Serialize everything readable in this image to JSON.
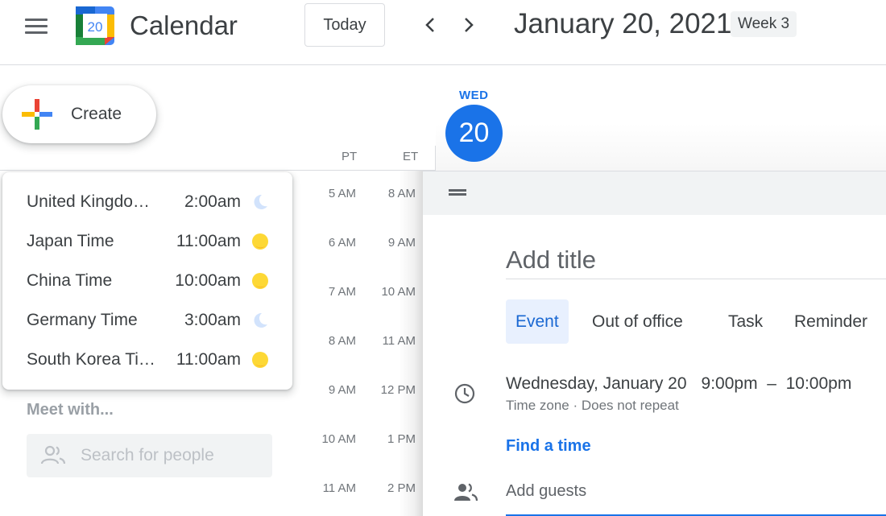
{
  "header": {
    "app_title": "Calendar",
    "logo_number": "20",
    "today_label": "Today",
    "date_title": "January 20, 2021",
    "week_badge": "Week 3"
  },
  "sidebar": {
    "create_label": "Create",
    "world_clock": [
      {
        "name": "United Kingdo…",
        "time": "2:00am",
        "icon": "moon-icon"
      },
      {
        "name": "Japan Time",
        "time": "11:00am",
        "icon": "sun-icon"
      },
      {
        "name": "China Time",
        "time": "10:00am",
        "icon": "sun-icon"
      },
      {
        "name": "Germany Time",
        "time": "3:00am",
        "icon": "moon-icon"
      },
      {
        "name": "South Korea Ti…",
        "time": "11:00am",
        "icon": "sun-icon"
      }
    ],
    "meet_with_label": "Meet with...",
    "people_search_placeholder": "Search for people"
  },
  "time_gutter": {
    "tz_labels": [
      "PT",
      "ET"
    ],
    "rows": [
      {
        "pt": "5 AM",
        "et": "8 AM"
      },
      {
        "pt": "6 AM",
        "et": "9 AM"
      },
      {
        "pt": "7 AM",
        "et": "10 AM"
      },
      {
        "pt": "8 AM",
        "et": "11 AM"
      },
      {
        "pt": "9 AM",
        "et": "12 PM"
      },
      {
        "pt": "10 AM",
        "et": "1 PM"
      },
      {
        "pt": "11 AM",
        "et": "2 PM"
      }
    ]
  },
  "day_header": {
    "dow": "WED",
    "day_number": "20"
  },
  "event_panel": {
    "title_placeholder": "Add title",
    "tabs": [
      "Event",
      "Out of office",
      "Task",
      "Reminder"
    ],
    "active_tab": "Event",
    "date_text": "Wednesday, January 20",
    "start_time": "9:00pm",
    "dash": "–",
    "end_time": "10:00pm",
    "subline": "Time zone · Does not repeat",
    "find_time": "Find a time",
    "guests_placeholder": "Add guests"
  },
  "colors": {
    "accent_blue": "#1a73e8",
    "active_tab_bg": "#e8f0fe",
    "sun_yellow": "#fdd835",
    "moon_blue": "#d2e3fc",
    "text_dark": "#3c4043",
    "text_muted": "#70757a"
  }
}
